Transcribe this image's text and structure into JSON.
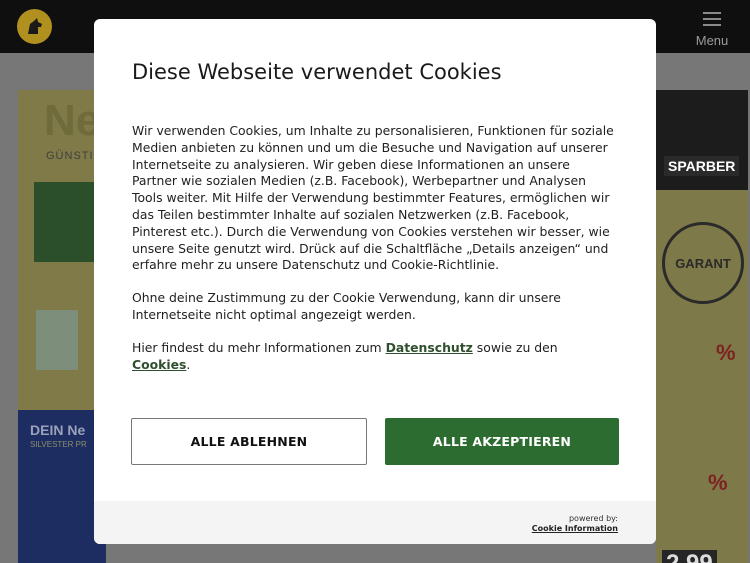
{
  "header": {
    "menu_label": "Menu"
  },
  "background": {
    "left_flyer": {
      "headline": "Ne",
      "subline": "GÜNSTI",
      "band_title": "DEIN Ne",
      "band_sub": "SILVESTER PR"
    },
    "right_flyer": {
      "banner": "SPARBER",
      "stamp_text": "GARANT",
      "price": "2.99"
    }
  },
  "cookie_dialog": {
    "title": "Diese Webseite verwendet Cookies",
    "paragraph1": "Wir verwenden Cookies, um Inhalte zu personalisieren, Funktionen für soziale Medien anbieten zu können und um die Besuche und Navigation auf unserer Internetseite zu analysieren. Wir geben diese Informationen an unsere Partner wie sozialen Medien (z.B. Facebook), Werbepartner und Analysen Tools weiter. Mit Hilfe der Verwendung bestimmter Features, ermöglichen wir das Teilen bestimmter Inhalte auf sozialen Netzwerken (z.B. Facebook, Pinterest etc.). Durch die Verwendung von Cookies verstehen wir besser, wie unsere Seite genutzt wird. Drück auf die Schaltfläche „Details anzeigen“ und erfahre mehr zu unsere Datenschutz und Cookie-Richtlinie.",
    "paragraph2": "Ohne deine Zustimmung zu der Cookie Verwendung, kann dir unsere Internetseite nicht optimal angezeigt werden.",
    "paragraph3_prefix": "Hier findest du mehr Informationen zum ",
    "link_privacy": "Datenschutz",
    "paragraph3_middle": " sowie zu den ",
    "link_cookies": "Cookies",
    "paragraph3_suffix": ".",
    "reject_button": "ALLE ABLEHNEN",
    "accept_button": "ALLE AKZEPTIEREN",
    "powered_by": "powered by:",
    "powered_by_link": "Cookie Information"
  },
  "colors": {
    "accept_button": "#2c6c30",
    "link": "#2f4f2f",
    "header": "#0f0f0f",
    "overlay": "#5c5c5c"
  }
}
